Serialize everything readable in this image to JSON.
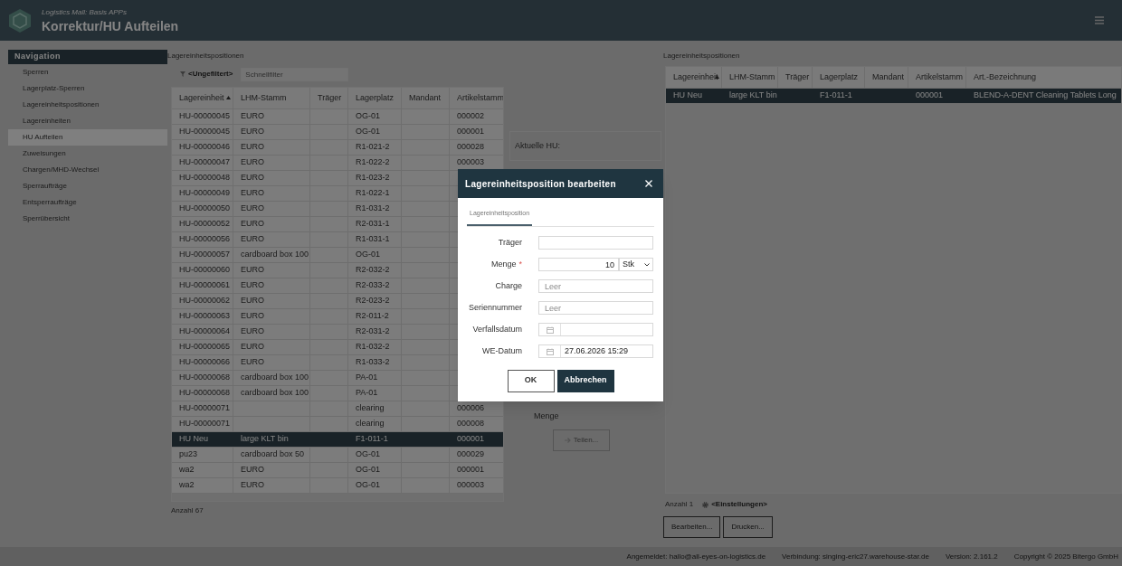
{
  "header": {
    "subtitle": "Logistics Mall: Basis APPs",
    "title": "Korrektur/HU Aufteilen"
  },
  "navigation": {
    "title": "Navigation",
    "items": [
      {
        "label": "Sperren",
        "selected": false
      },
      {
        "label": "Lagerplatz-Sperren",
        "selected": false
      },
      {
        "label": "Lagereinheitspositionen",
        "selected": false
      },
      {
        "label": "Lagereinheiten",
        "selected": false
      },
      {
        "label": "HU Aufteilen",
        "selected": true
      },
      {
        "label": "Zuweisungen",
        "selected": false
      },
      {
        "label": "Chargen/MHD-Wechsel",
        "selected": false
      },
      {
        "label": "Sperraufträge",
        "selected": false
      },
      {
        "label": "Entsperraufträge",
        "selected": false
      },
      {
        "label": "Sperrübersicht",
        "selected": false
      }
    ]
  },
  "left_panel": {
    "title": "Lagereinheitspositionen",
    "filter": "<Ungefiltert>",
    "quickfilter_placeholder": "Schnellfilter",
    "columns": [
      {
        "label": "Lagereinheit",
        "sorted": true
      },
      {
        "label": "LHM-Stamm",
        "sorted": false
      },
      {
        "label": "Träger",
        "sorted": false
      },
      {
        "label": "Lagerplatz",
        "sorted": false
      },
      {
        "label": "Mandant",
        "sorted": false
      },
      {
        "label": "Artikelstamm",
        "sorted": false
      }
    ],
    "rows": [
      {
        "lagereinheit": "HU-00000045",
        "lhm_stamm": "EURO",
        "lagerplatz": "OG-01",
        "artikelstamm": "000002",
        "selected": false
      },
      {
        "lagereinheit": "HU-00000045",
        "lhm_stamm": "EURO",
        "lagerplatz": "OG-01",
        "artikelstamm": "000001",
        "selected": false
      },
      {
        "lagereinheit": "HU-00000046",
        "lhm_stamm": "EURO",
        "lagerplatz": "R1-021-2",
        "artikelstamm": "000028",
        "selected": false
      },
      {
        "lagereinheit": "HU-00000047",
        "lhm_stamm": "EURO",
        "lagerplatz": "R1-022-2",
        "artikelstamm": "000003",
        "selected": false
      },
      {
        "lagereinheit": "HU-00000048",
        "lhm_stamm": "EURO",
        "lagerplatz": "R1-023-2",
        "selected": false
      },
      {
        "lagereinheit": "HU-00000049",
        "lhm_stamm": "EURO",
        "lagerplatz": "R1-022-1",
        "selected": false
      },
      {
        "lagereinheit": "HU-00000050",
        "lhm_stamm": "EURO",
        "lagerplatz": "R1-031-2",
        "selected": false
      },
      {
        "lagereinheit": "HU-00000052",
        "lhm_stamm": "EURO",
        "lagerplatz": "R2-031-1",
        "selected": false
      },
      {
        "lagereinheit": "HU-00000056",
        "lhm_stamm": "EURO",
        "lagerplatz": "R1-031-1",
        "selected": false
      },
      {
        "lagereinheit": "HU-00000057",
        "lhm_stamm": "cardboard box 100",
        "lagerplatz": "OG-01",
        "selected": false
      },
      {
        "lagereinheit": "HU-00000060",
        "lhm_stamm": "EURO",
        "lagerplatz": "R2-032-2",
        "selected": false
      },
      {
        "lagereinheit": "HU-00000061",
        "lhm_stamm": "EURO",
        "lagerplatz": "R2-033-2",
        "selected": false
      },
      {
        "lagereinheit": "HU-00000062",
        "lhm_stamm": "EURO",
        "lagerplatz": "R2-023-2",
        "selected": false
      },
      {
        "lagereinheit": "HU-00000063",
        "lhm_stamm": "EURO",
        "lagerplatz": "R2-011-2",
        "selected": false
      },
      {
        "lagereinheit": "HU-00000064",
        "lhm_stamm": "EURO",
        "lagerplatz": "R2-031-2",
        "selected": false
      },
      {
        "lagereinheit": "HU-00000065",
        "lhm_stamm": "EURO",
        "lagerplatz": "R1-032-2",
        "selected": false
      },
      {
        "lagereinheit": "HU-00000066",
        "lhm_stamm": "EURO",
        "lagerplatz": "R1-033-2",
        "selected": false
      },
      {
        "lagereinheit": "HU-00000068",
        "lhm_stamm": "cardboard box 100",
        "lagerplatz": "PA-01",
        "selected": false
      },
      {
        "lagereinheit": "HU-00000068",
        "lhm_stamm": "cardboard box 100",
        "lagerplatz": "PA-01",
        "selected": false
      },
      {
        "lagereinheit": "HU-00000071",
        "lagerplatz": "clearing",
        "artikelstamm": "000006",
        "selected": false
      },
      {
        "lagereinheit": "HU-00000071",
        "lagerplatz": "clearing",
        "artikelstamm": "000008",
        "selected": false
      },
      {
        "lagereinheit": "HU Neu",
        "lhm_stamm": "large KLT bin",
        "lagerplatz": "F1-011-1",
        "artikelstamm": "000001",
        "selected": true
      },
      {
        "lagereinheit": "pu23",
        "lhm_stamm": "cardboard box 50",
        "lagerplatz": "OG-01",
        "artikelstamm": "000029",
        "selected": false
      },
      {
        "lagereinheit": "wa2",
        "lhm_stamm": "EURO",
        "lagerplatz": "OG-01",
        "artikelstamm": "000001",
        "selected": false
      },
      {
        "lagereinheit": "wa2",
        "lhm_stamm": "EURO",
        "lagerplatz": "OG-01",
        "artikelstamm": "000003",
        "selected": false
      }
    ],
    "count": "Anzahl 67"
  },
  "split_panel": {
    "current_hu_label": "Aktuelle HU:",
    "quantity_label": "Menge",
    "split_button": "Teilen..."
  },
  "right_panel": {
    "title": "Lagereinheitspositionen",
    "columns": [
      {
        "label": "Lagereinheit",
        "sorted": true
      },
      {
        "label": "LHM-Stamm",
        "sorted": false
      },
      {
        "label": "Träger",
        "sorted": false
      },
      {
        "label": "Lagerplatz",
        "sorted": false
      },
      {
        "label": "Mandant",
        "sorted": false
      },
      {
        "label": "Artikelstamm",
        "sorted": false
      },
      {
        "label": "Art.-Bezeichnung",
        "sorted": false
      }
    ],
    "rows": [
      {
        "lagereinheit": "HU Neu",
        "lhm_stamm": "large KLT bin",
        "lagerplatz": "F1-011-1",
        "artikelstamm": "000001",
        "art_bezeichnung": "BLEND-A-DENT Cleaning Tablets Long",
        "selected": true
      }
    ],
    "count": "Anzahl 1",
    "settings": "<Einstellungen>",
    "buttons": [
      "Bearbeiten...",
      "Drucken..."
    ]
  },
  "dialog": {
    "title": "Lagereinheitsposition bearbeiten",
    "required_marker": "*",
    "tabs": [
      {
        "label": "Lagereinheitsposition",
        "selected": true
      }
    ],
    "fields": [
      {
        "kind": "text",
        "label": "Träger",
        "required": false
      },
      {
        "kind": "quantity",
        "label": "Menge",
        "required": true,
        "value": "10",
        "unit": "Stk"
      },
      {
        "kind": "text",
        "label": "Charge",
        "required": false,
        "placeholder": "Leer"
      },
      {
        "kind": "text",
        "label": "Seriennummer",
        "required": false,
        "placeholder": "Leer"
      },
      {
        "kind": "date",
        "label": "Verfallsdatum",
        "required": false
      },
      {
        "kind": "date",
        "label": "WE-Datum",
        "required": false,
        "value": "27.06.2026 15:29"
      }
    ],
    "buttons": [
      {
        "label": "OK",
        "kind": "secondary"
      },
      {
        "label": "Abbrechen",
        "kind": "primary"
      }
    ]
  },
  "status_bar": [
    "Angemeldet: hallo@all-eyes-on-logistics.de",
    "Verbindung: singing-eric27.warehouse-star.de",
    "Version: 2.161.2",
    "Copyright © 2025 Bitergo GmbH"
  ]
}
